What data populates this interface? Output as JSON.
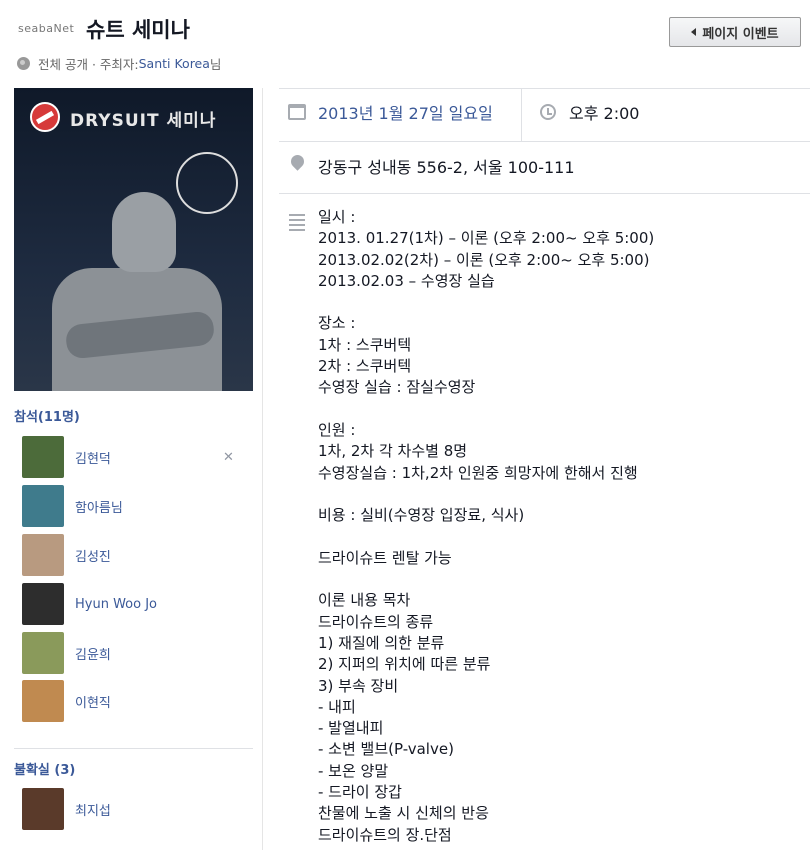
{
  "header": {
    "watermark": "seabaNet",
    "title": "슈트 세미나",
    "page_event_button": "페이지 이벤트"
  },
  "privacy": {
    "prefix": "전체 공개 · 주최자: ",
    "host": "Santi Korea",
    "suffix": "님"
  },
  "poster": {
    "title": "DRYSUIT 세미나"
  },
  "attending": {
    "heading": "참석(11명)",
    "people": [
      {
        "name": "김현덕",
        "avatar_color": "#4c6b3a"
      },
      {
        "name": "함아름님",
        "avatar_color": "#3f7b8c"
      },
      {
        "name": "김성진",
        "avatar_color": "#b89a80"
      },
      {
        "name": "Hyun Woo Jo",
        "avatar_color": "#2d2d2d"
      },
      {
        "name": "김윤희",
        "avatar_color": "#8a9a5b"
      },
      {
        "name": "이현직",
        "avatar_color": "#c08a50"
      }
    ]
  },
  "maybe": {
    "heading": "불확실 (3)",
    "people": [
      {
        "name": "최지섭",
        "avatar_color": "#5a3a2a"
      }
    ]
  },
  "event": {
    "date": "2013년 1월 27일 일요일",
    "time": "오후 2:00",
    "address": "강동구 성내동 556-2, 서울 100-111",
    "description_lines": [
      "일시 :",
      "2013. 01.27(1차) – 이론 (오후 2:00~ 오후 5:00)",
      "2013.02.02(2차) – 이론 (오후 2:00~ 오후 5:00)",
      "2013.02.03 – 수영장 실습",
      "",
      "장소 :",
      "1차 : 스쿠버텍",
      "2차 : 스쿠버텍",
      "수영장 실습 : 잠실수영장",
      "",
      "인원 :",
      "1차, 2차 각 차수별 8명",
      "수영장실습 : 1차,2차 인원중 희망자에 한해서 진행",
      "",
      "비용 : 실비(수영장 입장료, 식사)",
      "",
      "드라이슈트 렌탈 가능",
      "",
      "이론 내용 목차",
      "드라이슈트의 종류",
      "1) 재질에 의한 분류",
      "2) 지퍼의 위치에 따른 분류",
      "3) 부속 장비",
      "- 내피",
      "- 발열내피",
      "- 소변 밸브(P-valve)",
      "- 보온 양말",
      "- 드라이 장갑",
      "찬물에 노출 시 신체의 반응",
      "드라이슈트의 장.단점"
    ]
  }
}
